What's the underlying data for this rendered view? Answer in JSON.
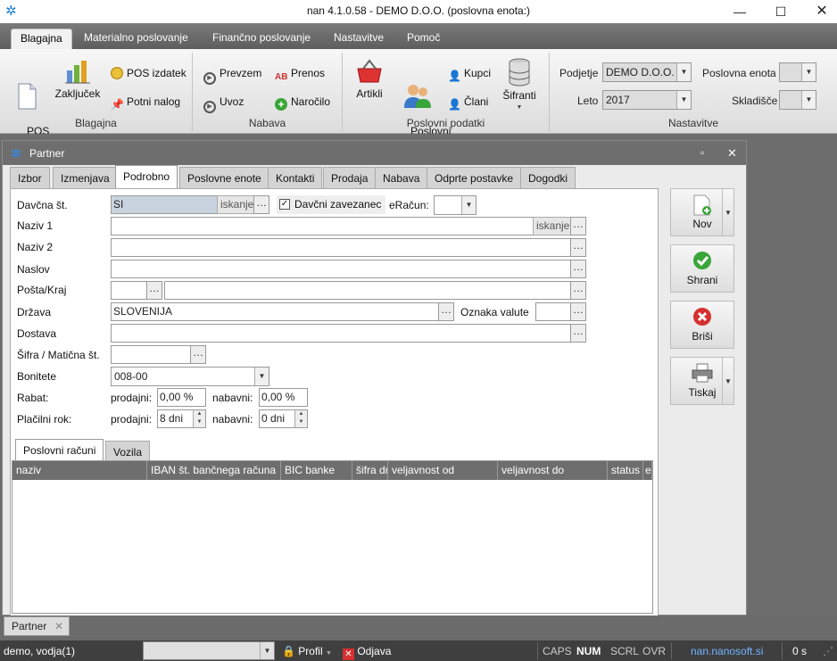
{
  "window": {
    "title": "nan 4.1.0.58 - DEMO D.O.O. (poslovna enota:)"
  },
  "ribbon_tabs": [
    "Blagajna",
    "Materialno poslovanje",
    "Finančno poslovanje",
    "Nastavitve",
    "Pomoč"
  ],
  "ribbon": {
    "blagajna": {
      "label": "Blagajna",
      "pos_racun": "POS\nračun",
      "zakljucek": "Zaključek",
      "pos_izdatek": "POS izdatek",
      "potni_nalog": "Potni nalog"
    },
    "nabava": {
      "label": "Nabava",
      "prevzem": "Prevzem",
      "uvoz": "Uvoz",
      "prenos": "Prenos",
      "narocilo": "Naročilo"
    },
    "poslovni": {
      "label": "Poslovni podatki",
      "artikli": "Artikli",
      "partnerji": "Poslovni\npartnerji",
      "kupci": "Kupci",
      "clani": "Člani",
      "sifranti": "Šifranti"
    },
    "nastavitve": {
      "label": "Nastavitve",
      "podjetje_label": "Podjetje",
      "podjetje_value": "DEMO D.O.O.",
      "leto_label": "Leto",
      "leto_value": "2017",
      "poslovna_enota_label": "Poslovna enota",
      "skladisce_label": "Skladišče"
    }
  },
  "child": {
    "title": "Partner",
    "tabs": [
      "Izbor",
      "Izmenjava",
      "Podrobno",
      "Poslovne enote",
      "Kontakti",
      "Prodaja",
      "Nabava",
      "Odprte postavke",
      "Dogodki"
    ]
  },
  "form": {
    "davcna_label": "Davčna št.",
    "davcna_value": "SI",
    "iskanje": "iskanje",
    "davcni_zavezanec": "Davčni zavezanec",
    "eracun_label": "eRačun:",
    "naziv1": "Naziv 1",
    "naziv2": "Naziv 2",
    "naslov": "Naslov",
    "posta": "Pošta/Kraj",
    "drzava_label": "Država",
    "drzava_value": "SLOVENIJA",
    "valuta_label": "Oznaka valute",
    "dostava": "Dostava",
    "sifra": "Šifra / Matična št.",
    "bonitete_label": "Bonitete",
    "bonitete_value": "008-00",
    "rabat": "Rabat:",
    "placilni": "Plačilni rok:",
    "prodajni": "prodajni:",
    "nabavni": "nabavni:",
    "rabat_prod": "0,00 %",
    "rabat_nab": "0,00 %",
    "rok_prod": "8 dni",
    "rok_nab": "0 dni"
  },
  "side": {
    "nov": "Nov",
    "shrani": "Shrani",
    "brisi": "Briši",
    "tiskaj": "Tiskaj"
  },
  "subtabs": [
    "Poslovni računi",
    "Vozila"
  ],
  "grid_columns": [
    "naziv",
    "IBAN št. bančnega računa",
    "BIC banke",
    "šifra dr",
    "veljavnost od",
    "veljavnost do",
    "status",
    "e"
  ],
  "doc_tab": "Partner",
  "status": {
    "user": "demo, vodja(1)",
    "profil": "Profil",
    "odjava": "Odjava",
    "caps": "CAPS",
    "num": "NUM",
    "scrl": "SCRL",
    "ovr": "OVR",
    "site": "nan.nanosoft.si",
    "time": "0 s"
  }
}
